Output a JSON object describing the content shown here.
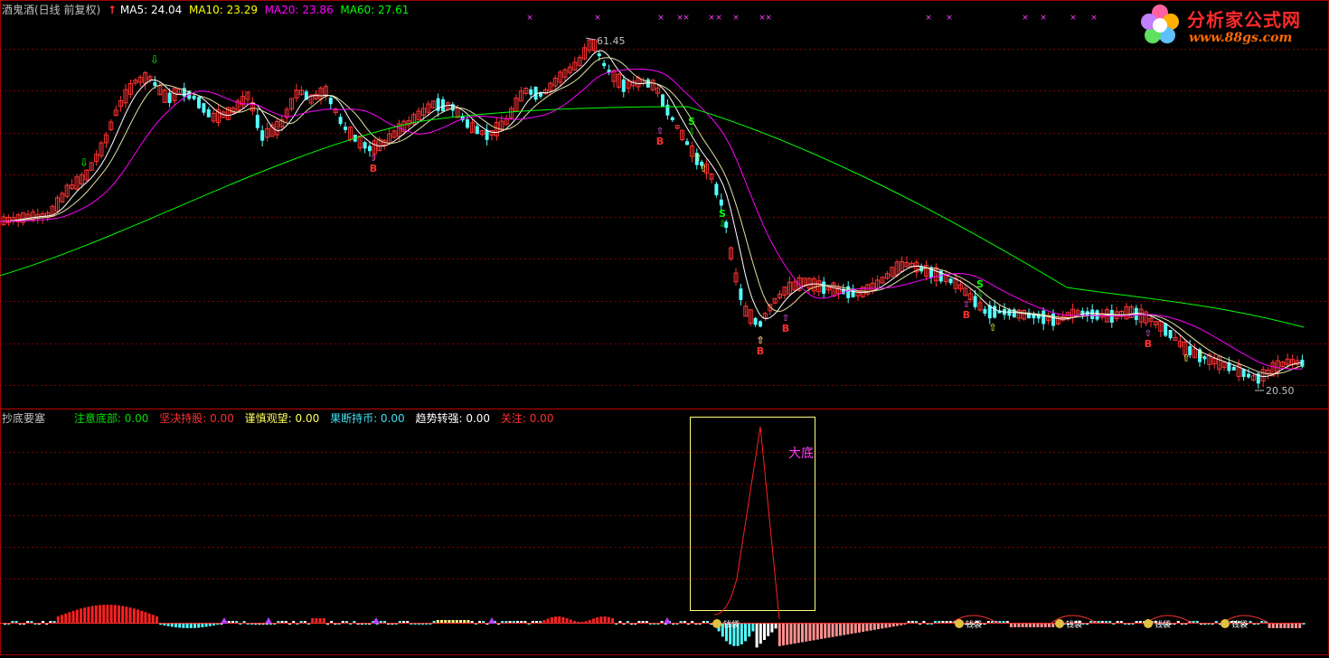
{
  "top_header": {
    "title": "酒鬼酒(日线 前复权)",
    "ma5": "MA5: 24.04",
    "ma10": "MA10: 23.29",
    "ma20": "MA20: 23.86",
    "ma60": "MA60: 27.61"
  },
  "bottom_header": {
    "title": "抄底要塞",
    "items": [
      {
        "label": "注意底部: 0.00",
        "color": "#00e000"
      },
      {
        "label": "坚决持股: 0.00",
        "color": "#ff3030"
      },
      {
        "label": "谨慎观望: 0.00",
        "color": "#ffff60"
      },
      {
        "label": "果断持币: 0.00",
        "color": "#40e0f0"
      },
      {
        "label": "趋势转强: 0.00",
        "color": "#ffffff"
      },
      {
        "label": "关注: 0.00",
        "color": "#ff3030"
      }
    ]
  },
  "annotations": {
    "high_price": "61.45",
    "low_price": "20.50",
    "big_bottom": "大底",
    "buy_label": "B",
    "sell_label": "S",
    "cross_mark": "×",
    "money_bag": "钱袋"
  },
  "watermark": {
    "brand": "分析家公式网",
    "url": "www.88gs.com"
  },
  "colors": {
    "up": "#ff3232",
    "down": "#54fcfc",
    "ma5": "#ffffff",
    "ma10": "#ffff00",
    "ma20": "#ff00ff",
    "ma60": "#00ff00",
    "grid": "#800000",
    "box": "#ffff80"
  },
  "chart_data": {
    "type": "candlestick",
    "series": [
      {
        "name": "MA5",
        "value": 24.04
      },
      {
        "name": "MA10",
        "value": 23.29
      },
      {
        "name": "MA20",
        "value": 23.86
      },
      {
        "name": "MA60",
        "value": 27.61
      }
    ],
    "high": 61.45,
    "low": 20.5
  }
}
